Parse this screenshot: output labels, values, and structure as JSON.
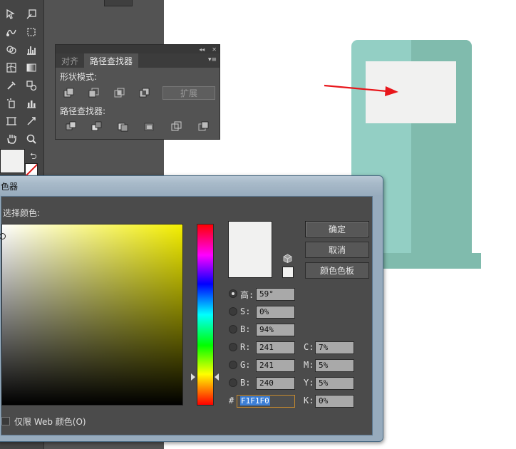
{
  "pathfinder_panel": {
    "tabs": [
      {
        "label": "对齐",
        "active": false
      },
      {
        "label": "路径查找器",
        "active": true
      }
    ],
    "shape_modes_label": "形状模式:",
    "pathfinders_label": "路径查找器:",
    "expand_label": "扩展",
    "collapse_glyph": "◂◂",
    "close_glyph": "✕",
    "menu_glyph": "▾≡"
  },
  "color_picker": {
    "title": "色器",
    "select_color_label": "选择颜色:",
    "ok_label": "确定",
    "cancel_label": "取消",
    "swatches_label": "颜色色板",
    "web_only_label": "仅限 Web 颜色(O)",
    "web_only_checked": false,
    "selected_mode": "H",
    "current_color": "#f1f1f0",
    "fields": {
      "h": {
        "label": "高:",
        "value": "59°"
      },
      "s": {
        "label": "S:",
        "value": "0%"
      },
      "b": {
        "label": "B:",
        "value": "94%"
      },
      "r": {
        "label": "R:",
        "value": "241"
      },
      "g": {
        "label": "G:",
        "value": "241"
      },
      "b2": {
        "label": "B:",
        "value": "240"
      },
      "c": {
        "label": "C:",
        "value": "7%"
      },
      "m": {
        "label": "M:",
        "value": "5%"
      },
      "y": {
        "label": "Y:",
        "value": "5%"
      },
      "k": {
        "label": "K:",
        "value": "0%"
      },
      "hex_prefix": "#",
      "hex": "F1F1F0"
    }
  },
  "colors": {
    "app_bg": "#535353",
    "toolbar": "#454545",
    "art_teal_light": "#93cfc4",
    "art_teal_dark": "#80bbad",
    "art_screen": "#f1f1f0",
    "arrow": "#e8161b"
  },
  "toolbar_icons": [
    "direct-selection-icon",
    "free-transform-icon",
    "warp-icon",
    "crop-icon",
    "shape-builder-icon",
    "graph-icon",
    "mesh-icon",
    "gradient-icon",
    "eyedropper-icon",
    "blend-icon",
    "symbol-sprayer-icon",
    "column-graph-icon",
    "artboard-icon",
    "slice-icon",
    "hand-icon",
    "zoom-icon"
  ]
}
